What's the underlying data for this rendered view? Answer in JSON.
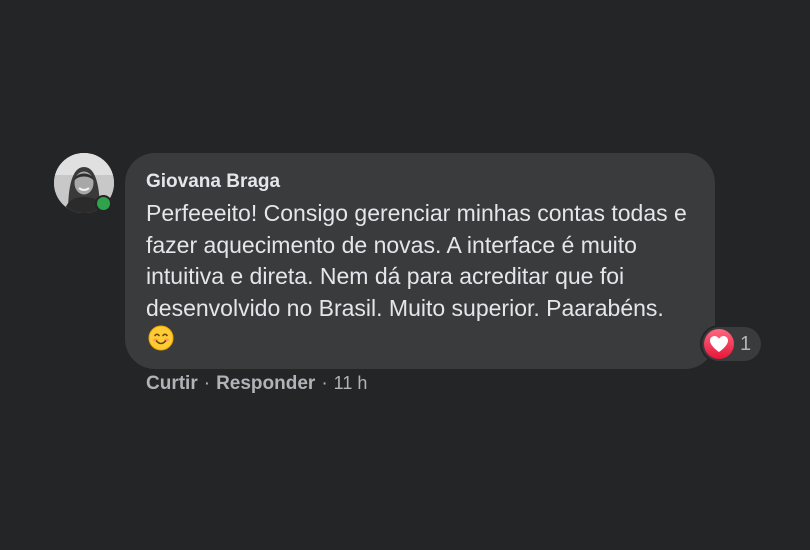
{
  "comment": {
    "author": "Giovana Braga",
    "text": "Perfeeeito! Consigo gerenciar minhas contas todas e fazer aquecimento de novas. A interface é muito intuitiva e direta. Nem dá para acreditar que foi desenvolvido no Brasil. Muito superior. Paarabéns.",
    "emoji_icon": "smiling-face-icon",
    "online": true,
    "reaction": {
      "icon": "heart-icon",
      "count": "1"
    },
    "actions": {
      "like": "Curtir",
      "reply": "Responder",
      "separator": "·",
      "time": "11 h"
    }
  },
  "colors": {
    "background": "#242526",
    "bubble": "#3a3b3c",
    "text": "#e4e6eb",
    "secondary": "#b0b3b8",
    "online": "#31a24c",
    "heart": "#f33e58"
  }
}
